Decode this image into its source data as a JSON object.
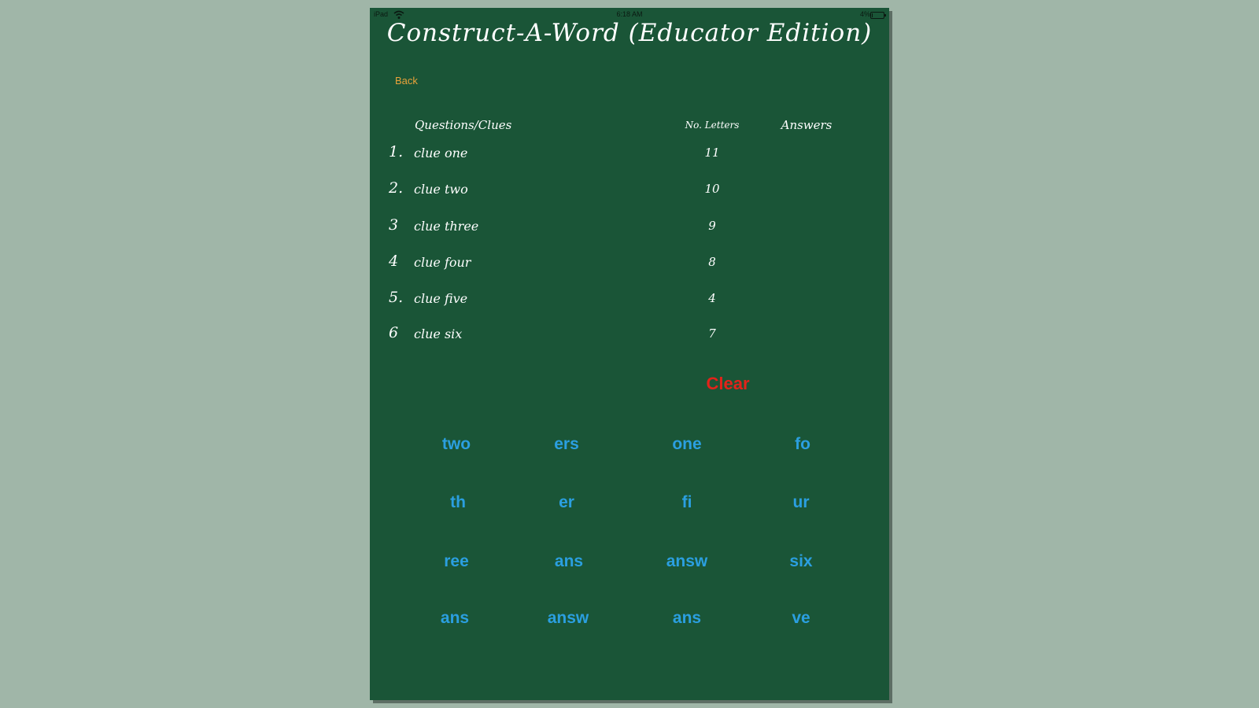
{
  "status_bar": {
    "carrier": "iPad",
    "time": "6:18 AM",
    "battery_pct": "4%",
    "battery_level": 0.04
  },
  "title": "Construct-A-Word (Educator Edition)",
  "back_label": "Back",
  "table": {
    "headers": {
      "clue": "Questions/Clues",
      "letters": "No. Letters",
      "answers": "Answers"
    },
    "rows": [
      {
        "num": "1.",
        "clue": "clue one",
        "letters": "11",
        "answer": ""
      },
      {
        "num": "2.",
        "clue": "clue two",
        "letters": "10",
        "answer": ""
      },
      {
        "num": "3",
        "clue": "clue three",
        "letters": "9",
        "answer": ""
      },
      {
        "num": "4",
        "clue": "clue four",
        "letters": "8",
        "answer": ""
      },
      {
        "num": "5.",
        "clue": "clue five",
        "letters": "4",
        "answer": ""
      },
      {
        "num": "6",
        "clue": "clue six",
        "letters": "7",
        "answer": ""
      }
    ]
  },
  "clear_label": "Clear",
  "tiles": [
    [
      "two",
      "ers",
      "one",
      "fo"
    ],
    [
      "th",
      "er",
      "fi",
      "ur"
    ],
    [
      "ree",
      "ans",
      "answ",
      "six"
    ],
    [
      "ans",
      "answ",
      "ans",
      "ve"
    ]
  ],
  "colors": {
    "board": "#1a5537",
    "background": "#a0b6a8",
    "tile_text": "#2b9fe0",
    "clear_text": "#e2231a",
    "back_text": "#e8a23a"
  }
}
